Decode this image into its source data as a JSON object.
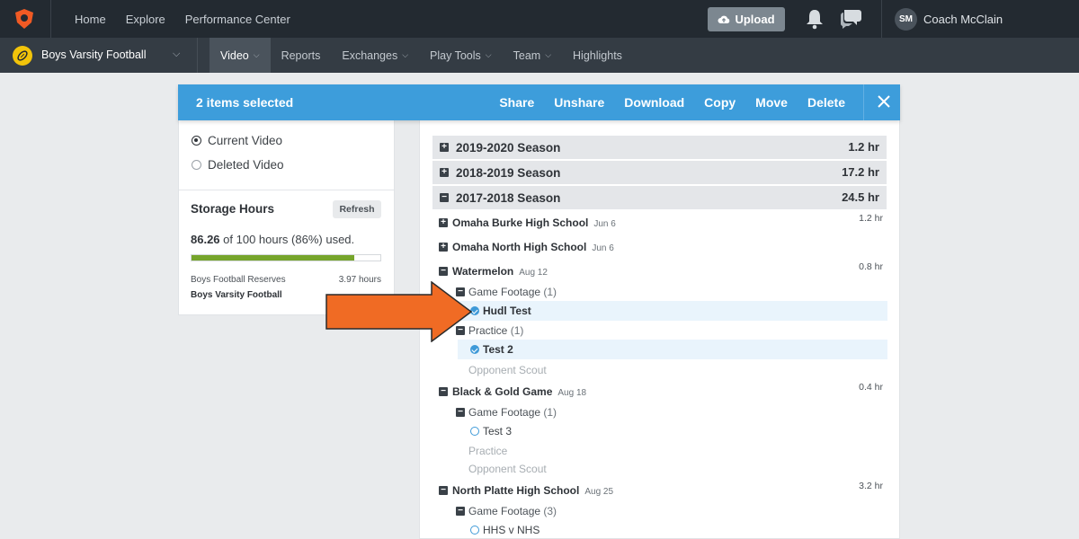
{
  "topnav": {
    "links": [
      "Home",
      "Explore",
      "Performance Center"
    ],
    "upload_label": "Upload",
    "user_initials": "SM",
    "user_name": "Coach McClain"
  },
  "subnav": {
    "team": "Boys Varsity Football",
    "items": [
      {
        "label": "Video",
        "active": true,
        "dropdown": true
      },
      {
        "label": "Reports",
        "active": false,
        "dropdown": false
      },
      {
        "label": "Exchanges",
        "active": false,
        "dropdown": true
      },
      {
        "label": "Play Tools",
        "active": false,
        "dropdown": true
      },
      {
        "label": "Team",
        "active": false,
        "dropdown": true
      },
      {
        "label": "Highlights",
        "active": false,
        "dropdown": false
      }
    ]
  },
  "banner": {
    "count": "2 items selected",
    "actions": [
      "Share",
      "Unshare",
      "Download",
      "Copy",
      "Move",
      "Delete"
    ]
  },
  "left": {
    "radios": [
      {
        "label": "Current Video",
        "checked": true
      },
      {
        "label": "Deleted Video",
        "checked": false
      }
    ],
    "storage_title": "Storage Hours",
    "refresh_label": "Refresh",
    "usage_value": "86.26",
    "usage_text": " of 100 hours (86%) used.",
    "usage_fraction": 0.86,
    "teams": [
      {
        "name": "Boys Football Reserves",
        "hours": "3.97 hours"
      },
      {
        "name": "Boys Varsity Football",
        "hours": ""
      }
    ]
  },
  "seasons": [
    {
      "label": "2019-2020 Season",
      "hours": "1.2 hr",
      "expanded": false
    },
    {
      "label": "2018-2019 Season",
      "hours": "17.2 hr",
      "expanded": false
    },
    {
      "label": "2017-2018 Season",
      "hours": "24.5 hr",
      "expanded": true
    }
  ],
  "games": [
    {
      "name": "Omaha Burke High School",
      "date": "Jun 6",
      "hours": "1.2 hr"
    },
    {
      "name": "Omaha North High School",
      "date": "Jun 6",
      "hours": ""
    },
    {
      "name": "Watermelon",
      "date": "Aug 12",
      "hours": "0.8 hr"
    },
    {
      "name": "Black & Gold Game",
      "date": "Aug 18",
      "hours": "0.4 hr"
    },
    {
      "name": "North Platte High School",
      "date": "Aug 25",
      "hours": "3.2 hr"
    }
  ],
  "watermelon": {
    "game_footage": "Game Footage",
    "game_footage_count": "(1)",
    "clip1": "Hudl Test",
    "practice": "Practice",
    "practice_count": "(1)",
    "clip2": "Test 2",
    "opponent_scout": "Opponent Scout"
  },
  "blackgold": {
    "game_footage": "Game Footage",
    "game_footage_count": "(1)",
    "clip1": "Test 3",
    "practice": "Practice",
    "opponent_scout": "Opponent Scout"
  },
  "northplatte": {
    "game_footage": "Game Footage",
    "game_footage_count": "(3)",
    "clip1": "HHS v NHS"
  },
  "colors": {
    "banner": "#3d9ddb",
    "arrow": "#f06b24",
    "storage_bar": "#76a52b",
    "topbar": "#232a31"
  }
}
